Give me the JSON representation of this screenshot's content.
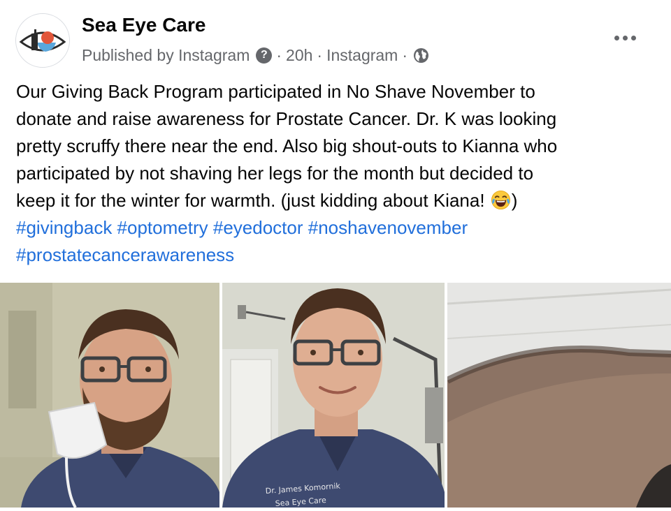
{
  "post": {
    "page_name": "Sea Eye Care",
    "avatar_icon": "sea-eye-care-logo-icon",
    "meta": {
      "published_by": "Published by Instagram",
      "help_icon_glyph": "?",
      "separator": "·",
      "time": "20h",
      "source": "Instagram",
      "audience_icon": "globe-icon"
    },
    "more_icon": "more-options-icon",
    "caption": {
      "lines": [
        "Our Giving Back Program participated in No Shave November to",
        "donate and raise awareness for Prostate Cancer. Dr. K was looking",
        "pretty scruffy there near the end. Also big shout-outs to Kianna who",
        "participated by not shaving her legs for the month but decided to"
      ],
      "last_line_before_emoji": "keep it for the winter for warmth. (just kidding about Kiana! ",
      "emoji": "laughing-tears-emoji",
      "last_line_after_emoji": ")"
    },
    "hashtags": [
      "#givingback",
      "#optometry",
      "#eyedoctor",
      "#noshavenovember",
      "#prostatecancerawareness"
    ],
    "photos": [
      {
        "name": "photo-doctor-with-mask"
      },
      {
        "name": "photo-doctor-in-exam-room",
        "scrubs_text_line1": "Dr. James Komornik",
        "scrubs_text_line2": "Sea Eye Care"
      },
      {
        "name": "photo-hairy-leg"
      }
    ],
    "colors": {
      "text": "#050505",
      "meta": "#65676b",
      "hashtag": "#216fdb",
      "scrubs": "#3e4a70"
    }
  }
}
